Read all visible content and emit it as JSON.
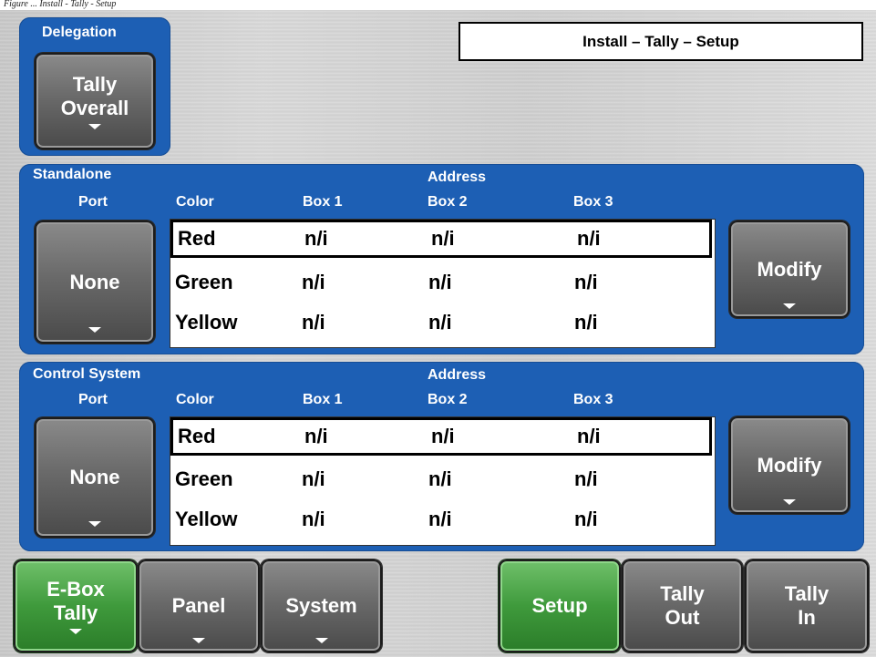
{
  "caption": "Figure ... Install - Tally - Setup",
  "delegation": {
    "label": "Delegation",
    "button": "Tally\nOverall"
  },
  "title": "Install – Tally – Setup",
  "standalone": {
    "section_label": "Standalone",
    "port_label": "Port",
    "address_label": "Address",
    "columns": {
      "color": "Color",
      "box1": "Box 1",
      "box2": "Box 2",
      "box3": "Box 3"
    },
    "port_button": "None",
    "modify_button": "Modify",
    "rows": [
      {
        "color": "Red",
        "box1": "n/i",
        "box2": "n/i",
        "box3": "n/i"
      },
      {
        "color": "Green",
        "box1": "n/i",
        "box2": "n/i",
        "box3": "n/i"
      },
      {
        "color": "Yellow",
        "box1": "n/i",
        "box2": "n/i",
        "box3": "n/i"
      }
    ]
  },
  "control": {
    "section_label": "Control System",
    "port_label": "Port",
    "address_label": "Address",
    "columns": {
      "color": "Color",
      "box1": "Box 1",
      "box2": "Box 2",
      "box3": "Box 3"
    },
    "port_button": "None",
    "modify_button": "Modify",
    "rows": [
      {
        "color": "Red",
        "box1": "n/i",
        "box2": "n/i",
        "box3": "n/i"
      },
      {
        "color": "Green",
        "box1": "n/i",
        "box2": "n/i",
        "box3": "n/i"
      },
      {
        "color": "Yellow",
        "box1": "n/i",
        "box2": "n/i",
        "box3": "n/i"
      }
    ]
  },
  "bottom_buttons": {
    "ebox_tally": "E-Box\nTally",
    "panel": "Panel",
    "system": "System",
    "setup": "Setup",
    "tally_out": "Tally\nOut",
    "tally_in": "Tally\nIn"
  },
  "colors": {
    "panel_blue": "#1d5fb4",
    "active_green": "#3f9a3c",
    "button_gray": "#6a6a6a"
  }
}
